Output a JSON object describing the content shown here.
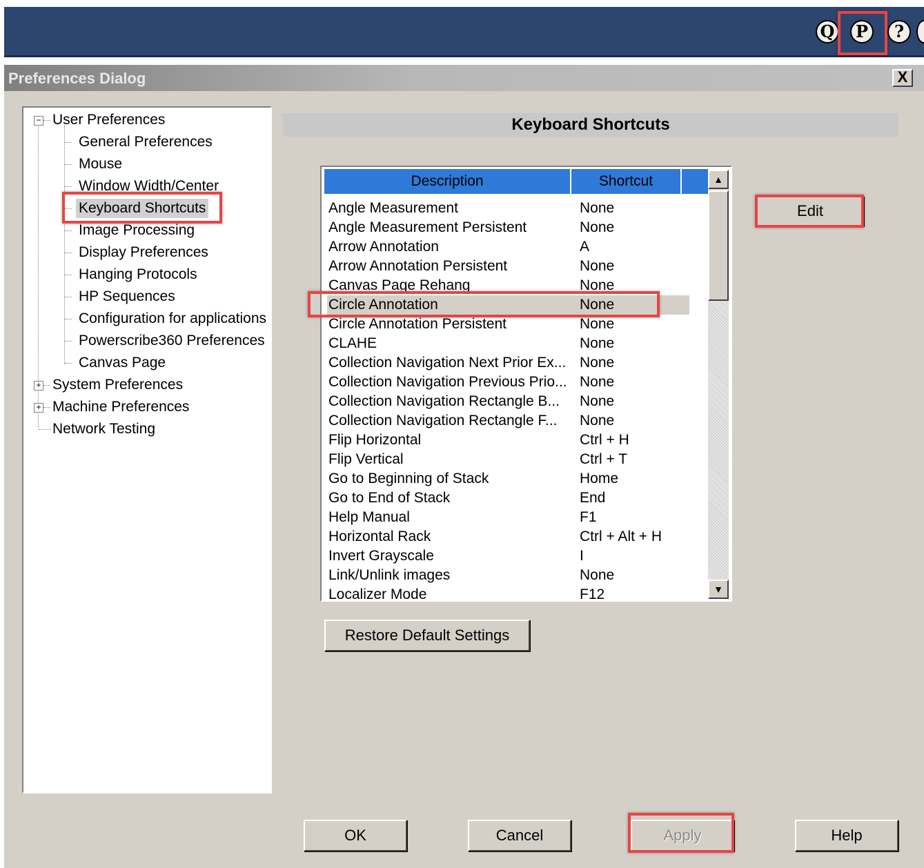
{
  "topbar": {
    "icons": [
      {
        "name": "q-icon",
        "glyph": "Q"
      },
      {
        "name": "preferences-icon",
        "glyph": "P"
      },
      {
        "name": "help-icon",
        "glyph": "?"
      }
    ]
  },
  "dialog": {
    "title": "Preferences Dialog",
    "close_label": "X"
  },
  "tree": {
    "user_preferences": "User Preferences",
    "children": [
      "General Preferences",
      "Mouse",
      "Window Width/Center",
      "Keyboard Shortcuts",
      "Image Processing",
      "Display Preferences",
      "Hanging Protocols",
      "HP Sequences",
      "Configuration for applications",
      "Powerscribe360 Preferences",
      "Canvas Page"
    ],
    "system_preferences": "System Preferences",
    "machine_preferences": "Machine Preferences",
    "network_testing": "Network Testing",
    "expand_minus": "−",
    "expand_plus": "+"
  },
  "panel": {
    "heading": "Keyboard Shortcuts",
    "col_description": "Description",
    "col_shortcut": "Shortcut",
    "edit_label": "Edit",
    "restore_label": "Restore Default Settings",
    "selected_row": 5,
    "rows": [
      {
        "d": "Angle Measurement",
        "s": "None"
      },
      {
        "d": "Angle Measurement Persistent",
        "s": "None"
      },
      {
        "d": "Arrow Annotation",
        "s": "A"
      },
      {
        "d": "Arrow Annotation Persistent",
        "s": "None"
      },
      {
        "d": "Canvas Page Rehang",
        "s": "None"
      },
      {
        "d": "Circle Annotation",
        "s": "None"
      },
      {
        "d": "Circle Annotation Persistent",
        "s": "None"
      },
      {
        "d": "CLAHE",
        "s": "None"
      },
      {
        "d": "Collection Navigation Next Prior Ex...",
        "s": "None"
      },
      {
        "d": "Collection Navigation Previous Prio...",
        "s": "None"
      },
      {
        "d": "Collection Navigation Rectangle B...",
        "s": "None"
      },
      {
        "d": "Collection Navigation Rectangle F...",
        "s": "None"
      },
      {
        "d": "Flip Horizontal",
        "s": "Ctrl + H"
      },
      {
        "d": "Flip Vertical",
        "s": "Ctrl + T"
      },
      {
        "d": "Go to Beginning of Stack",
        "s": "Home"
      },
      {
        "d": "Go to End of Stack",
        "s": "End"
      },
      {
        "d": "Help Manual",
        "s": "F1"
      },
      {
        "d": "Horizontal Rack",
        "s": "Ctrl + Alt + H"
      },
      {
        "d": "Invert Grayscale",
        "s": "I"
      },
      {
        "d": "Link/Unlink images",
        "s": "None"
      },
      {
        "d": "Localizer Mode",
        "s": "F12"
      }
    ],
    "scroll_up": "▲",
    "scroll_down": "▼"
  },
  "footer": {
    "ok": "OK",
    "cancel": "Cancel",
    "apply": "Apply",
    "help": "Help"
  },
  "colors": {
    "app_bar": "#2d4670",
    "header_blue": "#2f7ad8",
    "dialog_bg": "#d4d0c8",
    "highlight_red": "#e64545"
  }
}
